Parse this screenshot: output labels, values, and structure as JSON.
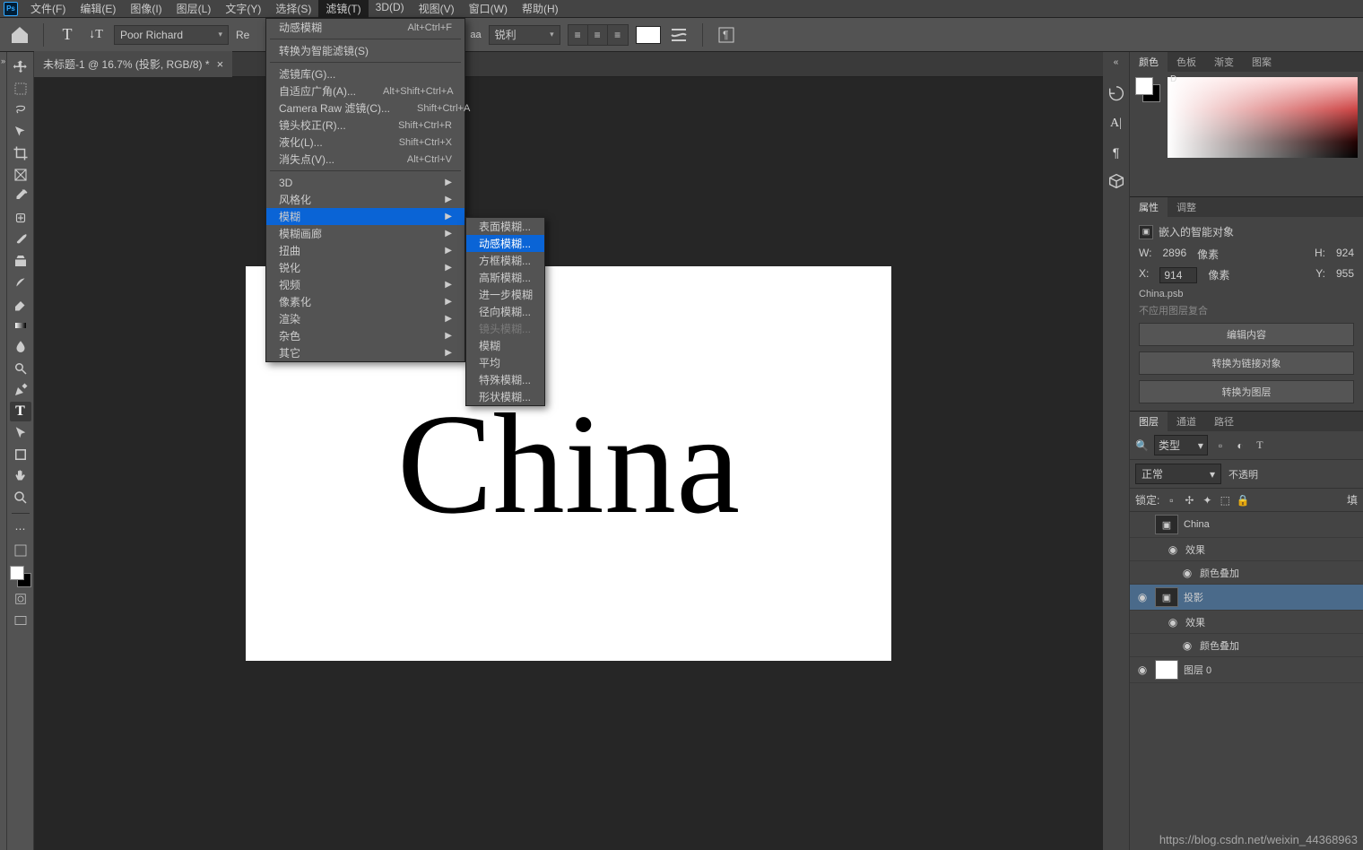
{
  "app_icon": "Ps",
  "menubar": {
    "items": [
      "文件(F)",
      "编辑(E)",
      "图像(I)",
      "图层(L)",
      "文字(Y)",
      "选择(S)",
      "滤镜(T)",
      "3D(D)",
      "视图(V)",
      "窗口(W)",
      "帮助(H)"
    ],
    "active_index": 6
  },
  "optionsbar": {
    "font_family": "Poor Richard",
    "re_label": "Re",
    "aa_prefix": "aa",
    "aa_value": "锐利"
  },
  "tab": {
    "title": "未标题-1 @ 16.7% (投影, RGB/8) *",
    "close": "×"
  },
  "canvas": {
    "text": "China"
  },
  "filter_menu": {
    "items": [
      {
        "label": "动感模糊",
        "shortcut": "Alt+Ctrl+F",
        "type": "item"
      },
      {
        "type": "sep"
      },
      {
        "label": "转换为智能滤镜(S)",
        "type": "item",
        "disabled": true
      },
      {
        "type": "sep"
      },
      {
        "label": "滤镜库(G)...",
        "type": "item"
      },
      {
        "label": "自适应广角(A)...",
        "shortcut": "Alt+Shift+Ctrl+A",
        "type": "item"
      },
      {
        "label": "Camera Raw 滤镜(C)...",
        "shortcut": "Shift+Ctrl+A",
        "type": "item"
      },
      {
        "label": "镜头校正(R)...",
        "shortcut": "Shift+Ctrl+R",
        "type": "item"
      },
      {
        "label": "液化(L)...",
        "shortcut": "Shift+Ctrl+X",
        "type": "item"
      },
      {
        "label": "消失点(V)...",
        "shortcut": "Alt+Ctrl+V",
        "type": "item",
        "disabled": true
      },
      {
        "type": "sep"
      },
      {
        "label": "3D",
        "sub": true,
        "type": "item"
      },
      {
        "label": "风格化",
        "sub": true,
        "type": "item"
      },
      {
        "label": "模糊",
        "sub": true,
        "type": "item",
        "highlighted": true
      },
      {
        "label": "模糊画廊",
        "sub": true,
        "type": "item"
      },
      {
        "label": "扭曲",
        "sub": true,
        "type": "item"
      },
      {
        "label": "锐化",
        "sub": true,
        "type": "item"
      },
      {
        "label": "视频",
        "sub": true,
        "type": "item"
      },
      {
        "label": "像素化",
        "sub": true,
        "type": "item"
      },
      {
        "label": "渲染",
        "sub": true,
        "type": "item"
      },
      {
        "label": "杂色",
        "sub": true,
        "type": "item"
      },
      {
        "label": "其它",
        "sub": true,
        "type": "item"
      }
    ]
  },
  "blur_submenu": {
    "items": [
      {
        "label": "表面模糊..."
      },
      {
        "label": "动感模糊...",
        "highlighted": true
      },
      {
        "label": "方框模糊..."
      },
      {
        "label": "高斯模糊..."
      },
      {
        "label": "进一步模糊"
      },
      {
        "label": "径向模糊..."
      },
      {
        "label": "镜头模糊...",
        "disabled": true
      },
      {
        "label": "模糊"
      },
      {
        "label": "平均"
      },
      {
        "label": "特殊模糊..."
      },
      {
        "label": "形状模糊..."
      }
    ]
  },
  "color_panel": {
    "tabs": [
      "颜色",
      "色板",
      "渐变",
      "图案"
    ],
    "d_label": "D"
  },
  "props_panel": {
    "tabs": [
      "属性",
      "调整"
    ],
    "header": "嵌入的智能对象",
    "w_label": "W:",
    "w_val": "2896",
    "w_unit": "像素",
    "h_label": "H:",
    "h_val": "924",
    "x_label": "X:",
    "x_val": "914",
    "x_unit": "像素",
    "y_label": "Y:",
    "y_val": "955",
    "file": "China.psb",
    "layer_comp": "不应用图层复合",
    "btn1": "编辑内容",
    "btn2": "转换为链接对象",
    "btn3": "转换为图层"
  },
  "layers_panel": {
    "tabs": [
      "图层",
      "通道",
      "路径"
    ],
    "filter_label": "类型",
    "blend_mode": "正常",
    "opacity_label": "不透明",
    "lock_label": "锁定:",
    "fill_label": "填",
    "layers": [
      {
        "vis": "",
        "name": "China",
        "selected": false,
        "thumb": "so"
      },
      {
        "vis": "◉",
        "name": "效果",
        "sub": true
      },
      {
        "vis": "◉",
        "name": "颜色叠加",
        "sub2": true
      },
      {
        "vis": "◉",
        "name": "投影",
        "selected": true,
        "thumb": "so"
      },
      {
        "vis": "◉",
        "name": "效果",
        "sub": true
      },
      {
        "vis": "◉",
        "name": "颜色叠加",
        "sub2": true
      },
      {
        "vis": "◉",
        "name": "图层 0",
        "thumb": "white"
      }
    ]
  },
  "watermark": "https://blog.csdn.net/weixin_44368963",
  "icons": {
    "search": "Q",
    "dbl": "»"
  }
}
